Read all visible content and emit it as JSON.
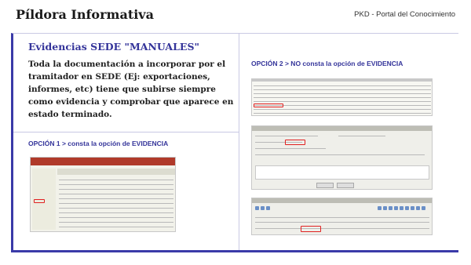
{
  "header": {
    "title": "Píldora Informativa",
    "right_text": "PKD - Portal del Conocimiento"
  },
  "evidencias": {
    "title": "Evidencias SEDE \"MANUALES\"",
    "body": "Toda la documentación a incorporar por el tramitador en SEDE (Ej: exportaciones, informes, etc) tiene que subirse siempre como evidencia y comprobar que aparece en estado terminado."
  },
  "option1": {
    "label": "OPCIÓN 1 > consta la opción de EVIDENCIA"
  },
  "option2": {
    "label": "OPCIÓN 2 > NO consta la opción de EVIDENCIA"
  },
  "colors": {
    "accent": "#3a3aa8",
    "highlight": "#e02020"
  }
}
